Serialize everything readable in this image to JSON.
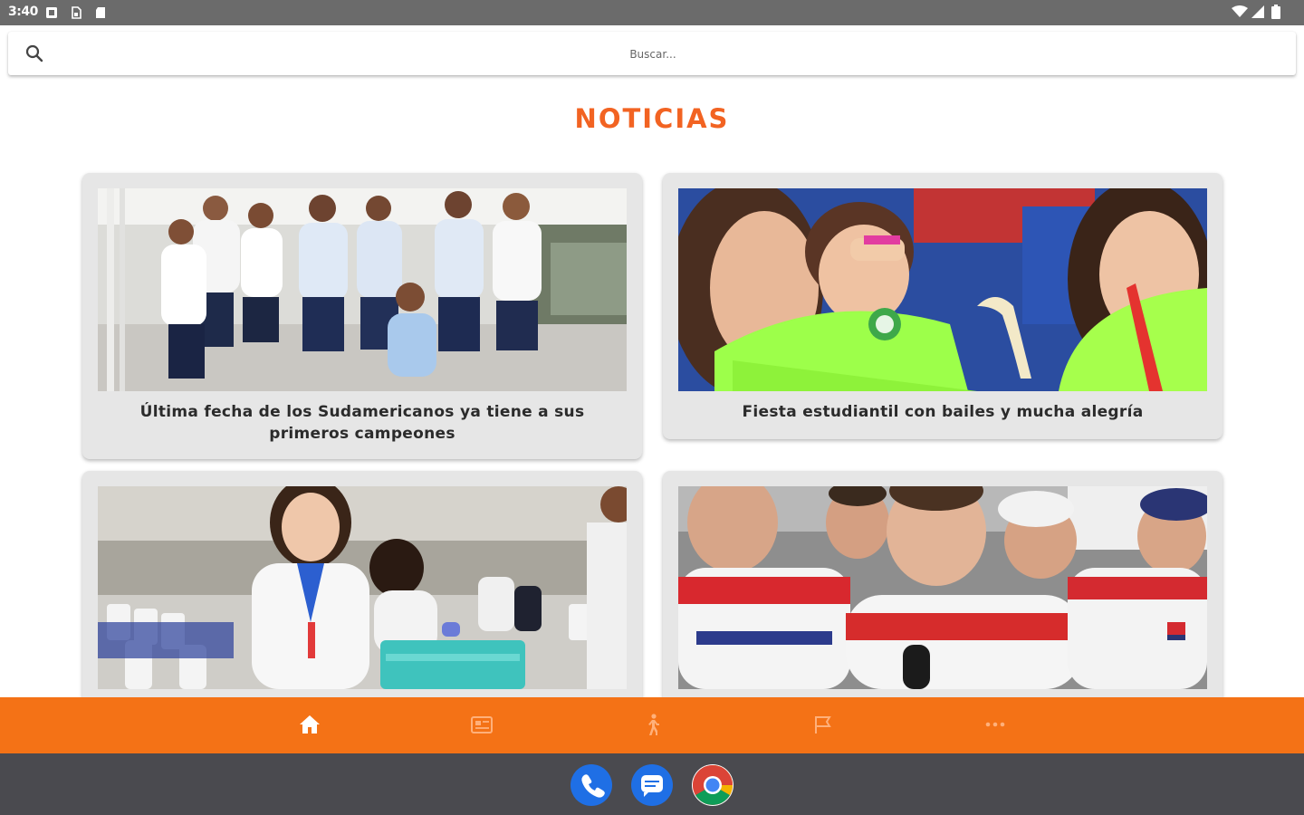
{
  "status_bar": {
    "time": "3:40",
    "left_icons": [
      "notification-icon",
      "sim-icon",
      "sd-card-icon"
    ],
    "right_icons": [
      "wifi-icon",
      "signal-icon",
      "battery-icon"
    ]
  },
  "search": {
    "placeholder": "Buscar...",
    "value": ""
  },
  "page_title": "NOTICIAS",
  "news": [
    {
      "caption": "Última fecha de los Sudamericanos ya tiene a sus primeros campeones"
    },
    {
      "caption": "Fiesta estudiantil con bailes y mucha alegría"
    },
    {
      "caption": ""
    },
    {
      "caption": ""
    }
  ],
  "bottom_nav": [
    {
      "icon": "home-icon",
      "active": true
    },
    {
      "icon": "news-icon",
      "active": false
    },
    {
      "icon": "running-person-icon",
      "active": false
    },
    {
      "icon": "flag-icon",
      "active": false
    },
    {
      "icon": "more-icon",
      "active": false
    }
  ],
  "dock": [
    {
      "icon": "phone-icon"
    },
    {
      "icon": "messages-icon"
    },
    {
      "icon": "chrome-icon"
    }
  ],
  "colors": {
    "accent": "#f26322",
    "nav_bar": "#f47216",
    "card_bg": "#e6e6e6",
    "status_bar": "#6b6b6b",
    "tray": "#4a4a4f"
  }
}
